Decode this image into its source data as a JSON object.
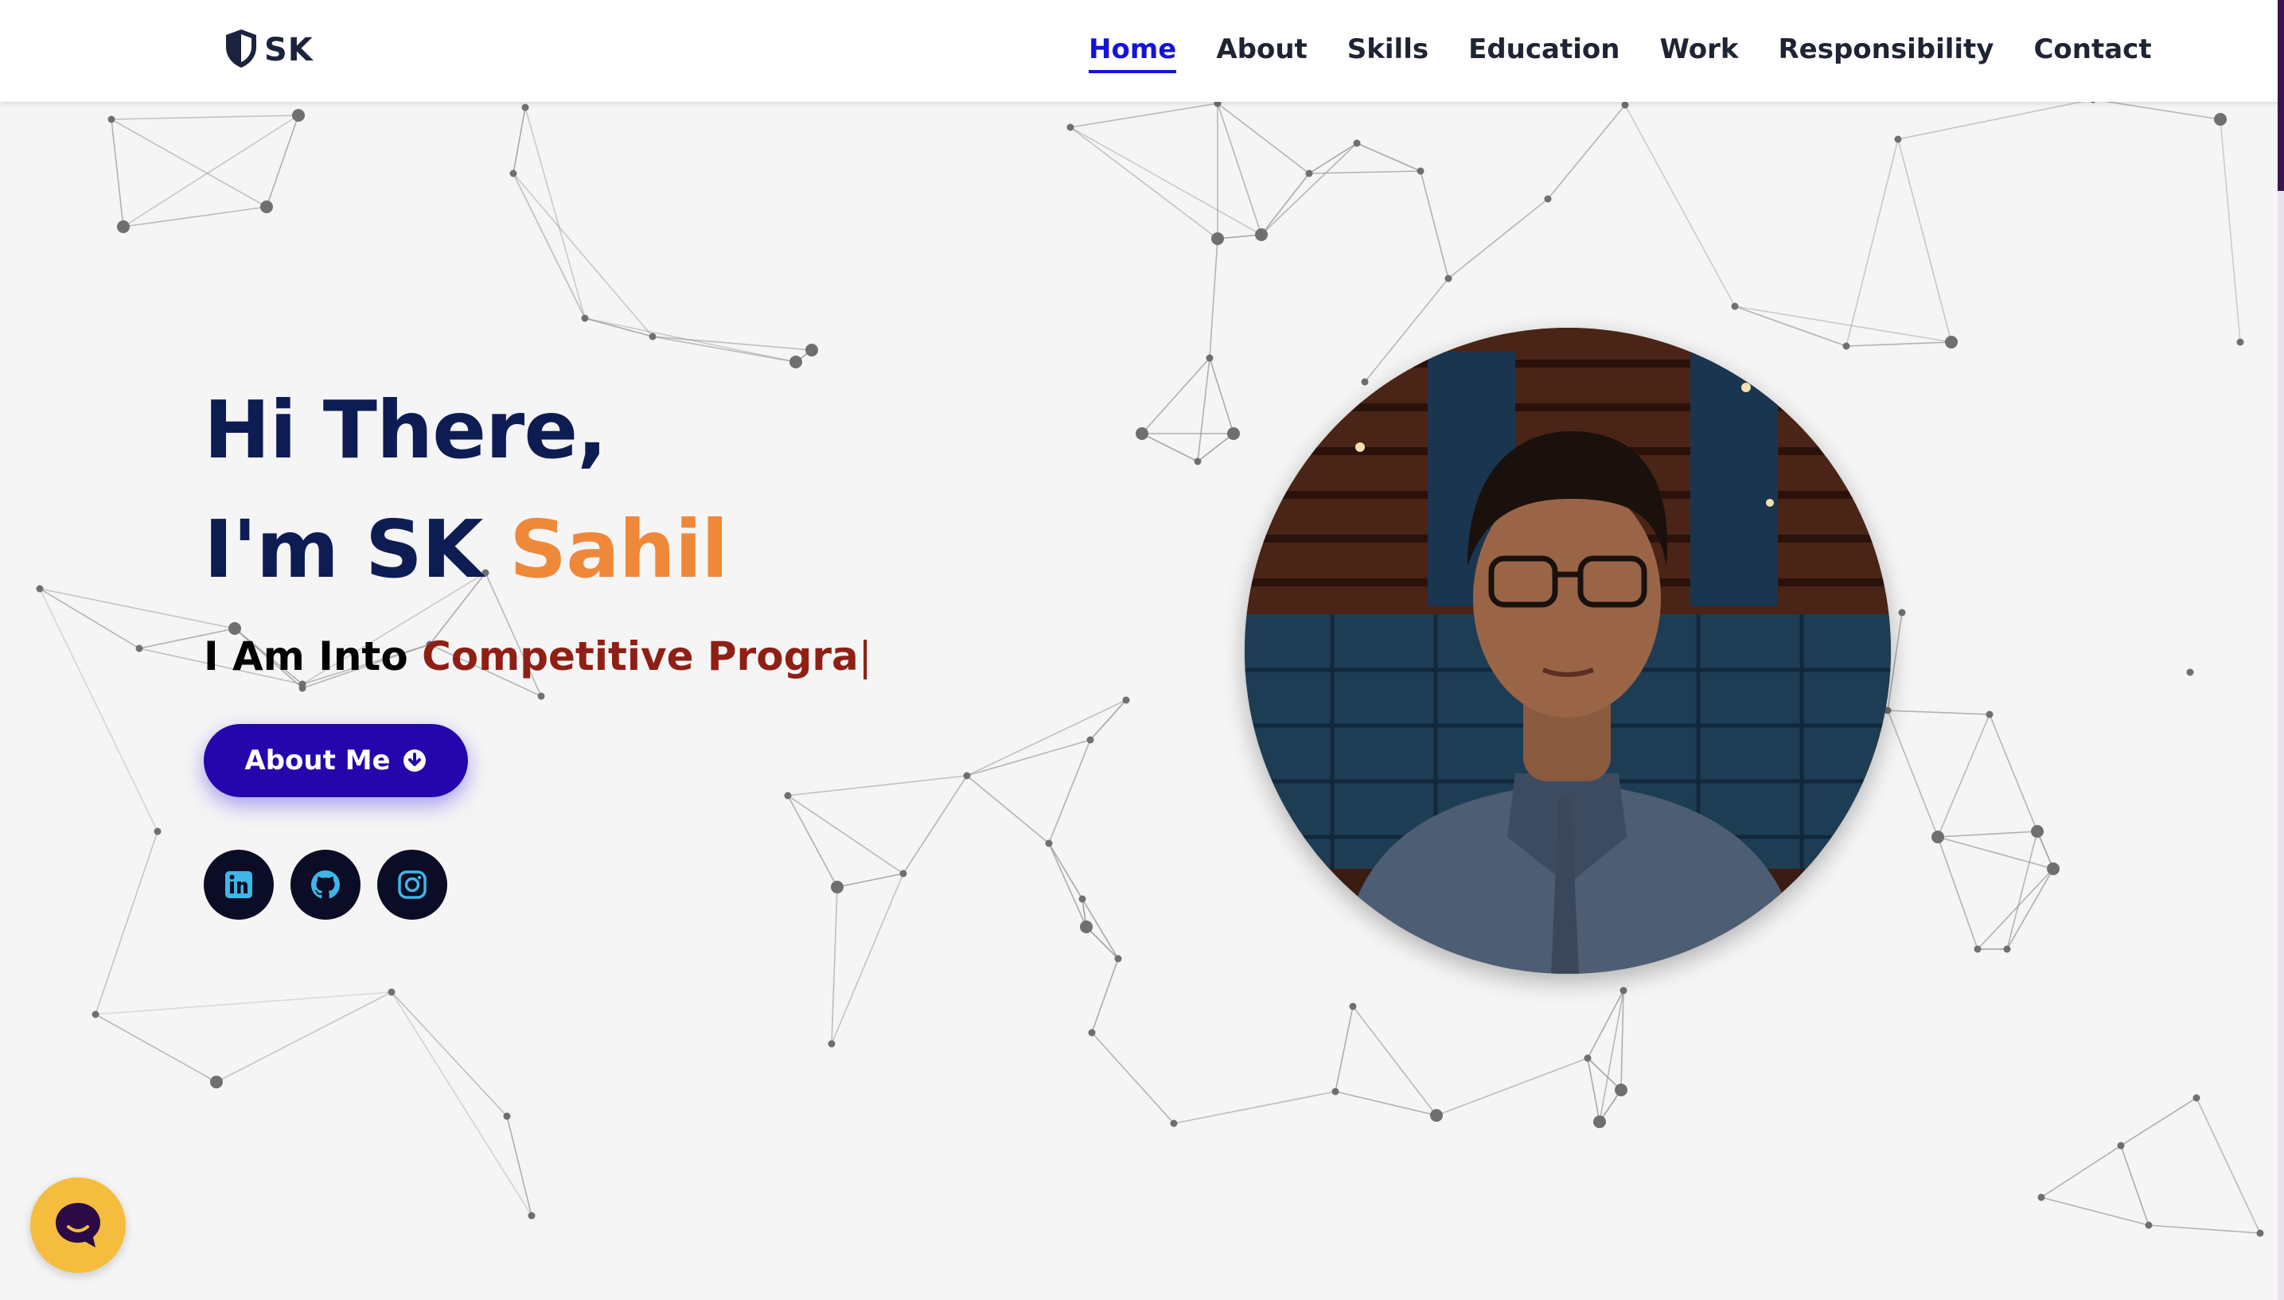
{
  "logo": {
    "text": "SK",
    "icon": "shield-icon"
  },
  "nav": {
    "items": [
      {
        "label": "Home",
        "active": true
      },
      {
        "label": "About",
        "active": false
      },
      {
        "label": "Skills",
        "active": false
      },
      {
        "label": "Education",
        "active": false
      },
      {
        "label": "Work",
        "active": false
      },
      {
        "label": "Responsibility",
        "active": false
      },
      {
        "label": "Contact",
        "active": false
      }
    ]
  },
  "hero": {
    "greeting": "Hi There,",
    "intro_prefix": "I'm SK ",
    "intro_name": "Sahil",
    "typed_prefix": "I Am Into ",
    "typed_text": "Competitive Progra",
    "typed_cursor": "|",
    "button_label": "About Me",
    "button_icon": "arrow-circle-down-icon"
  },
  "socials": [
    {
      "name": "linkedin",
      "icon": "linkedin-icon"
    },
    {
      "name": "github",
      "icon": "github-icon"
    },
    {
      "name": "instagram",
      "icon": "instagram-icon"
    }
  ],
  "colors": {
    "heading": "#0e1c54",
    "accent_orange": "#f0883a",
    "typed_red": "#8f1f14",
    "nav_active": "#1413d8",
    "button_bg": "#2506ad",
    "social_bg": "#0b0c25",
    "social_icon": "#3fb6e6",
    "chat_bg": "#f5bd3e",
    "background": "#f5f5f5"
  },
  "chat_widget": {
    "icon": "chat-bubble-icon"
  }
}
